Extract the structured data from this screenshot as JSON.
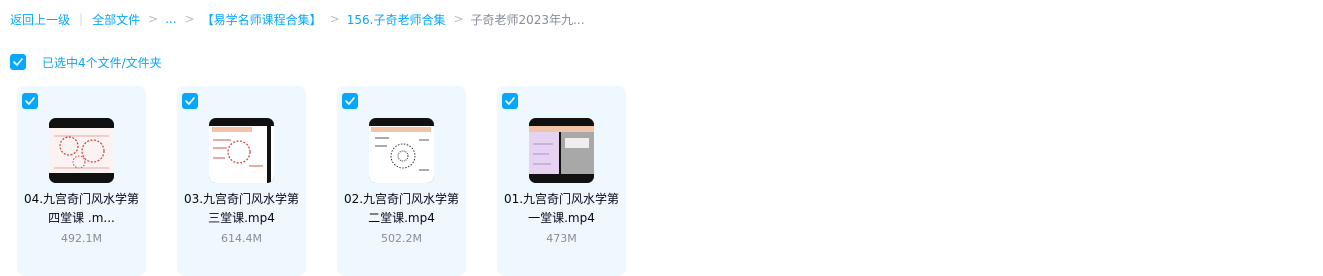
{
  "breadcrumb": {
    "back": "返回上一级",
    "all_files": "全部文件",
    "ellipsis": "...",
    "folder1": "【易学名师课程合集】",
    "folder2": "156.子奇老师合集",
    "current": "子奇老师2023年九..."
  },
  "selection": {
    "label": "已选中4个文件/文件夹"
  },
  "files": [
    {
      "name": "04.九宫奇门风水学第四堂课 .m...",
      "size": "492.1M",
      "selected": true,
      "thumb_icon": "video-thumbnail-icon"
    },
    {
      "name": "03.九宫奇门风水学第三堂课.mp4",
      "size": "614.4M",
      "selected": true,
      "thumb_icon": "video-thumbnail-icon"
    },
    {
      "name": "02.九宫奇门风水学第二堂课.mp4",
      "size": "502.2M",
      "selected": true,
      "thumb_icon": "video-thumbnail-icon"
    },
    {
      "name": "01.九宫奇门风水学第一堂课.mp4",
      "size": "473M",
      "selected": true,
      "thumb_icon": "video-thumbnail-icon"
    }
  ],
  "colors": {
    "accent": "#06a7ff",
    "card_bg": "#f0f8ff",
    "text": "#03081a",
    "muted": "#878c9c"
  }
}
